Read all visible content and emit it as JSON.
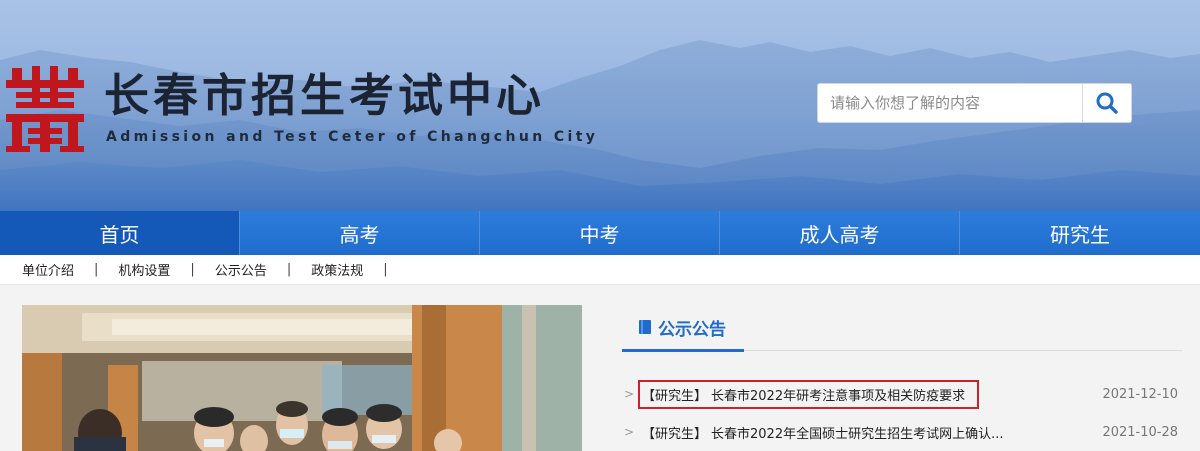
{
  "header": {
    "title": "长春市招生考试中心",
    "subtitle": "Admission and Test Ceter of Changchun City",
    "search_placeholder": "请输入你想了解的内容"
  },
  "main_nav": {
    "items": [
      {
        "label": "首页",
        "active": true
      },
      {
        "label": "高考",
        "active": false
      },
      {
        "label": "中考",
        "active": false
      },
      {
        "label": "成人高考",
        "active": false
      },
      {
        "label": "研究生",
        "active": false
      }
    ]
  },
  "sub_nav": {
    "items": [
      {
        "label": "单位介绍"
      },
      {
        "label": "机构设置"
      },
      {
        "label": "公示公告"
      },
      {
        "label": "政策法规"
      }
    ],
    "separator": "|"
  },
  "notices": {
    "title": "公示公告",
    "items": [
      {
        "tag": "【研究生】",
        "title": "长春市2022年研考注意事项及相关防疫要求",
        "date": "2021-12-10",
        "highlighted": true
      },
      {
        "tag": "【研究生】",
        "title": "长春市2022年全国硕士研究生招生考试网上确认...",
        "date": "2021-10-28",
        "highlighted": false
      }
    ],
    "arrow": ">"
  },
  "colors": {
    "nav_bg": "#1f6ccc",
    "nav_active": "#1458b8",
    "accent": "#1f6ccc",
    "logo_red": "#c0161e",
    "highlight_border": "#d0202a"
  }
}
